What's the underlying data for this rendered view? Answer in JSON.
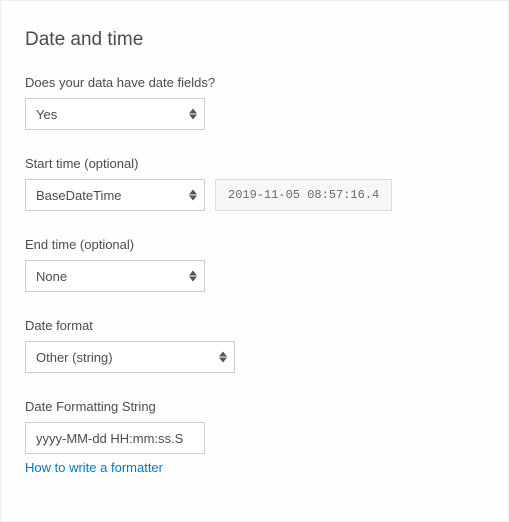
{
  "title": "Date and time",
  "hasDateFields": {
    "label": "Does your data have date fields?",
    "value": "Yes"
  },
  "startTime": {
    "label": "Start time (optional)",
    "value": "BaseDateTime",
    "preview": "2019-11-05 08:57:16.4"
  },
  "endTime": {
    "label": "End time (optional)",
    "value": "None"
  },
  "dateFormat": {
    "label": "Date format",
    "value": "Other (string)"
  },
  "formatString": {
    "label": "Date Formatting String",
    "value": "yyyy-MM-dd HH:mm:ss.S"
  },
  "helpLink": {
    "label": "How to write a formatter"
  }
}
